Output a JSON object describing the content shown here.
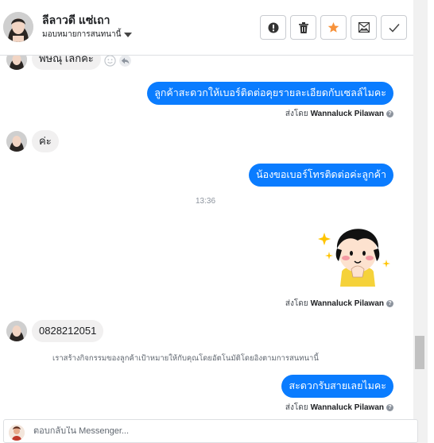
{
  "header": {
    "contact_name": "ลีลาวดี แซ่เถา",
    "assign_label": "มอบหมายการสนทนานี้",
    "actions": [
      {
        "name": "report-button",
        "icon": "exclamation-icon"
      },
      {
        "name": "delete-button",
        "icon": "trash-icon"
      },
      {
        "name": "star-button",
        "icon": "star-icon",
        "color": "#f7923b"
      },
      {
        "name": "mark-unread-button",
        "icon": "envelope-icon"
      },
      {
        "name": "done-button",
        "icon": "checkmark-icon"
      }
    ]
  },
  "messages": {
    "m1": "พิษณุ เลิกค่ะ",
    "m2": "ลูกค้าสะดวกให้เบอร์ติดต่อคุยรายละเอียดกับเซลล์ไมคะ",
    "m3": "ค่ะ",
    "m4": "น้องขอเบอร์โทรติดต่อค่ะลูกค้า",
    "time": "13:36",
    "m6": "0828212051",
    "system": "เราสร้างกิจกรรมของลูกค้าเป้าหมายให้กับคุณโดยอัตโนมัติโดยอิงตามการสนทนานี้",
    "m7": "สะดวกรับสายเลยไมคะ"
  },
  "sent_by": {
    "prefix": "ส่งโดย",
    "agent": "Wannaluck Pilawan",
    "info_glyph": "?"
  },
  "composer": {
    "placeholder": "ตอบกลับใน Messenger..."
  },
  "colors": {
    "outgoing_bubble": "#0a7cff",
    "incoming_bubble": "#f1f0f0",
    "star": "#f7923b"
  }
}
